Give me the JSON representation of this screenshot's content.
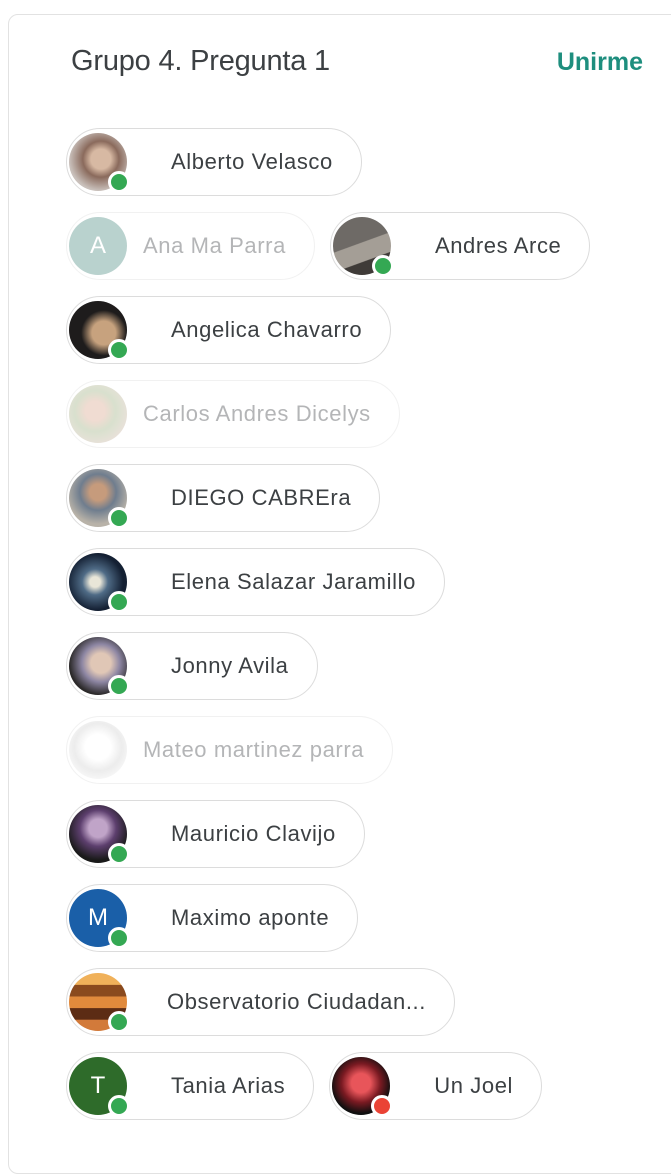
{
  "header": {
    "title": "Grupo 4. Pregunta 1",
    "join_label": "Unirme"
  },
  "colors": {
    "online": "#34a853",
    "busy": "#ea4335",
    "accent": "#1e8e7e"
  },
  "members": [
    {
      "name": "Alberto Velasco",
      "status": "online",
      "avatar": "photo"
    },
    {
      "name": "Ana Ma Parra",
      "status": "offline",
      "avatar": "initial",
      "initial": "A"
    },
    {
      "name": "Andres Arce",
      "status": "online",
      "avatar": "photo"
    },
    {
      "name": "Angelica Chavarro",
      "status": "online",
      "avatar": "photo"
    },
    {
      "name": "Carlos Andres Dicelys",
      "status": "offline",
      "avatar": "photo"
    },
    {
      "name": "DIEGO CABREra",
      "status": "online",
      "avatar": "photo"
    },
    {
      "name": "Elena Salazar Jaramillo",
      "status": "online",
      "avatar": "photo"
    },
    {
      "name": "Jonny Avila",
      "status": "online",
      "avatar": "photo"
    },
    {
      "name": "Mateo martinez parra",
      "status": "offline",
      "avatar": "photo"
    },
    {
      "name": "Mauricio Clavijo",
      "status": "online",
      "avatar": "photo"
    },
    {
      "name": "Maximo aponte",
      "status": "online",
      "avatar": "initial",
      "initial": "M"
    },
    {
      "name": "Observatorio Ciudadan...",
      "status": "online",
      "avatar": "photo"
    },
    {
      "name": "Tania Arias",
      "status": "online",
      "avatar": "initial",
      "initial": "T"
    },
    {
      "name": "Un Joel",
      "status": "busy",
      "avatar": "photo"
    }
  ]
}
